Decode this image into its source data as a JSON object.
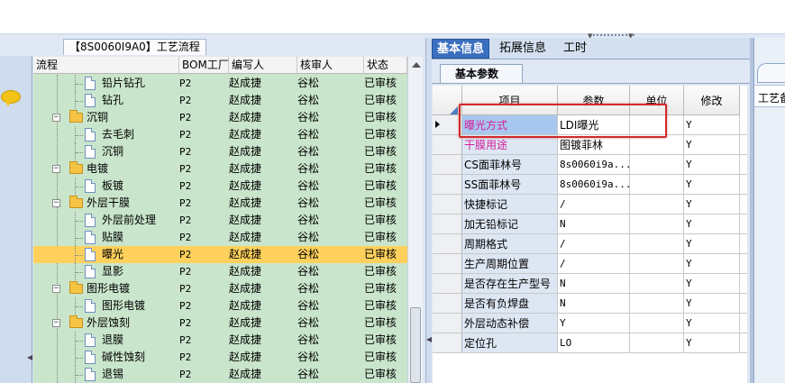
{
  "left_panel": {
    "title": "【8S0060I9A0】工艺流程",
    "columns": [
      "流程",
      "BOM工厂",
      "编写人",
      "核审人",
      "状态"
    ],
    "rows": [
      {
        "label": "铅片钻孔",
        "type": "file",
        "bom": "P2",
        "author": "赵成捷",
        "reviewer": "谷松",
        "status": "已审核"
      },
      {
        "label": "钻孔",
        "type": "file",
        "bom": "P2",
        "author": "赵成捷",
        "reviewer": "谷松",
        "status": "已审核"
      },
      {
        "label": "沉铜",
        "type": "folder",
        "bom": "P2",
        "author": "赵成捷",
        "reviewer": "谷松",
        "status": "已审核"
      },
      {
        "label": "去毛刺",
        "type": "file",
        "bom": "P2",
        "author": "赵成捷",
        "reviewer": "谷松",
        "status": "已审核"
      },
      {
        "label": "沉铜",
        "type": "file",
        "bom": "P2",
        "author": "赵成捷",
        "reviewer": "谷松",
        "status": "已审核"
      },
      {
        "label": "电镀",
        "type": "folder",
        "bom": "P2",
        "author": "赵成捷",
        "reviewer": "谷松",
        "status": "已审核"
      },
      {
        "label": "板镀",
        "type": "file",
        "bom": "P2",
        "author": "赵成捷",
        "reviewer": "谷松",
        "status": "已审核"
      },
      {
        "label": "外层干膜",
        "type": "folder",
        "bom": "P2",
        "author": "赵成捷",
        "reviewer": "谷松",
        "status": "已审核"
      },
      {
        "label": "外层前处理",
        "type": "file",
        "bom": "P2",
        "author": "赵成捷",
        "reviewer": "谷松",
        "status": "已审核"
      },
      {
        "label": "贴膜",
        "type": "file",
        "bom": "P2",
        "author": "赵成捷",
        "reviewer": "谷松",
        "status": "已审核"
      },
      {
        "label": "曝光",
        "type": "file",
        "bom": "P2",
        "author": "赵成捷",
        "reviewer": "谷松",
        "status": "已审核",
        "selected": true
      },
      {
        "label": "显影",
        "type": "file",
        "bom": "P2",
        "author": "赵成捷",
        "reviewer": "谷松",
        "status": "已审核"
      },
      {
        "label": "图形电镀",
        "type": "folder",
        "bom": "P2",
        "author": "赵成捷",
        "reviewer": "谷松",
        "status": "已审核"
      },
      {
        "label": "图形电镀",
        "type": "file",
        "bom": "P2",
        "author": "赵成捷",
        "reviewer": "谷松",
        "status": "已审核"
      },
      {
        "label": "外层蚀刻",
        "type": "folder",
        "bom": "P2",
        "author": "赵成捷",
        "reviewer": "谷松",
        "status": "已审核"
      },
      {
        "label": "退膜",
        "type": "file",
        "bom": "P2",
        "author": "赵成捷",
        "reviewer": "谷松",
        "status": "已审核"
      },
      {
        "label": "碱性蚀刻",
        "type": "file",
        "bom": "P2",
        "author": "赵成捷",
        "reviewer": "谷松",
        "status": "已审核"
      },
      {
        "label": "退锡",
        "type": "file",
        "bom": "P2",
        "author": "赵成捷",
        "reviewer": "谷松",
        "status": "已审核"
      }
    ]
  },
  "right_panel": {
    "tabs": [
      "基本信息",
      "拓展信息",
      "工时"
    ],
    "active_tab": 0,
    "subtab": "基本参数",
    "columns": [
      "项目",
      "参数",
      "单位",
      "修改"
    ],
    "rows": [
      {
        "item": "曝光方式",
        "param": "LDI曝光",
        "unit": "",
        "modify": "Y",
        "current": true
      },
      {
        "item": "干膜用途",
        "param": "图镀菲林",
        "unit": "",
        "modify": "Y",
        "pink": true
      },
      {
        "item": "CS面菲林号",
        "param": "8s0060i9a...",
        "unit": "",
        "modify": "Y"
      },
      {
        "item": "SS面菲林号",
        "param": "8s0060i9a...",
        "unit": "",
        "modify": "Y"
      },
      {
        "item": "快捷标记",
        "param": "/",
        "unit": "",
        "modify": "Y"
      },
      {
        "item": "加无铅标记",
        "param": "N",
        "unit": "",
        "modify": "Y"
      },
      {
        "item": "周期格式",
        "param": "/",
        "unit": "",
        "modify": "Y"
      },
      {
        "item": "生产周期位置",
        "param": "/",
        "unit": "",
        "modify": "Y"
      },
      {
        "item": "是否存在生产型号",
        "param": "N",
        "unit": "",
        "modify": "Y"
      },
      {
        "item": "是否有负焊盘",
        "param": "N",
        "unit": "",
        "modify": "Y"
      },
      {
        "item": "外层动态补偿",
        "param": "Y",
        "unit": "",
        "modify": "Y"
      },
      {
        "item": "定位孔",
        "param": "LO",
        "unit": "",
        "modify": "Y"
      }
    ]
  },
  "far_panel": {
    "label": "工艺备"
  },
  "colors": {
    "tree_bg": "#c9e5cb",
    "selected_row": "#ffd15c",
    "active_tab": "#3a6fbf",
    "pink_text": "#d21f9c",
    "highlight_border": "#d22a2a"
  },
  "icons": [
    "chat-bubble-icon",
    "folder-icon",
    "file-icon",
    "expander-minus-icon",
    "scroll-up-icon",
    "row-pointer-icon"
  ]
}
